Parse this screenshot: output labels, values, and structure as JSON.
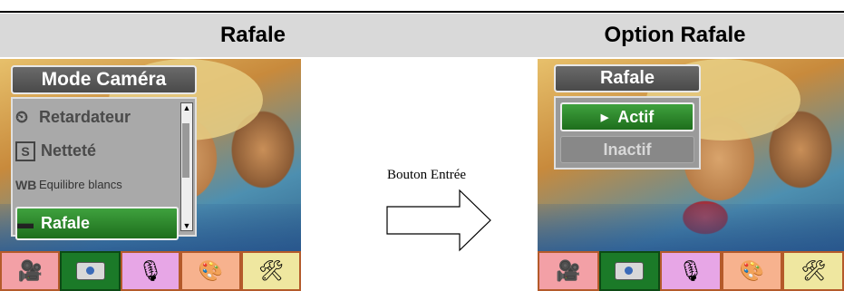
{
  "headers": {
    "left": "Rafale",
    "right": "Option Rafale"
  },
  "left_screen": {
    "menu_title": "Mode Caméra",
    "items": [
      {
        "icon": "timer-icon",
        "glyph": "⏲",
        "label": "Retardateur"
      },
      {
        "icon": "sharpness-icon",
        "glyph": "S",
        "label": "Netteté"
      },
      {
        "icon": "white-balance-icon",
        "glyph": "WB",
        "label": "Equilibre blancs"
      },
      {
        "icon": "burst-icon",
        "glyph": "▬",
        "label": "Rafale",
        "selected": true
      }
    ]
  },
  "right_screen": {
    "menu_title": "Rafale",
    "options": [
      {
        "label": "Actif",
        "selected": true
      },
      {
        "label": "Inactif",
        "selected": false
      }
    ]
  },
  "arrow_label": "Bouton Entrée",
  "bottom_icons": [
    "video-mode-icon",
    "camera-mode-icon",
    "audio-mode-icon",
    "effects-palette-icon",
    "settings-tools-icon"
  ],
  "colors": {
    "header_bg": "#d9d9d9",
    "selected_green": "#1e6e1c"
  }
}
